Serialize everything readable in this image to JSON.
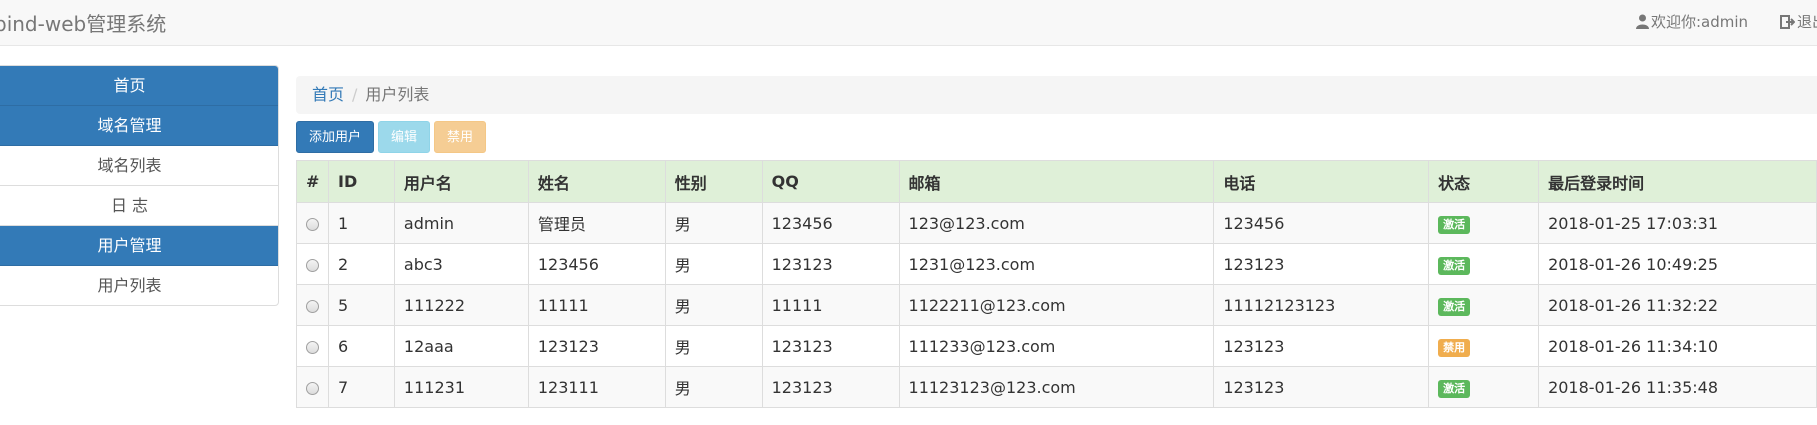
{
  "navbar": {
    "brand": "bind-web管理系统",
    "welcome": "欢迎你:admin",
    "welcome_icon": "user-icon",
    "logout": "退出",
    "logout_icon": "logout-icon"
  },
  "sidebar": {
    "items": [
      {
        "label": "首页",
        "active": true
      },
      {
        "label": "域名管理",
        "active": true
      },
      {
        "label": "域名列表",
        "active": false
      },
      {
        "label": "日 志",
        "active": false
      },
      {
        "label": "用户管理",
        "active": true
      },
      {
        "label": "用户列表",
        "active": false
      }
    ]
  },
  "breadcrumb": {
    "home": "首页",
    "separator": "/",
    "current": "用户列表"
  },
  "toolbar": {
    "add_label": "添加用户",
    "edit_label": "编辑",
    "disable_label": "禁用"
  },
  "table": {
    "headers": [
      "#",
      "ID",
      "用户名",
      "姓名",
      "性别",
      "QQ",
      "邮箱",
      "电话",
      "状态",
      "最后登录时间"
    ],
    "rows": [
      {
        "id": "1",
        "username": "admin",
        "name": "管理员",
        "gender": "男",
        "qq": "123456",
        "email": "123@123.com",
        "phone": "123456",
        "status": "激活",
        "last_login": "2018-01-25 17:03:31"
      },
      {
        "id": "2",
        "username": "abc3",
        "name": "123456",
        "gender": "男",
        "qq": "123123",
        "email": "1231@123.com",
        "phone": "123123",
        "status": "激活",
        "last_login": "2018-01-26 10:49:25"
      },
      {
        "id": "5",
        "username": "111222",
        "name": "11111",
        "gender": "男",
        "qq": "11111",
        "email": "1122211@123.com",
        "phone": "11112123123",
        "status": "激活",
        "last_login": "2018-01-26 11:32:22"
      },
      {
        "id": "6",
        "username": "12aaa",
        "name": "123123",
        "gender": "男",
        "qq": "123123",
        "email": "111233@123.com",
        "phone": "123123",
        "status": "禁用",
        "last_login": "2018-01-26 11:34:10"
      },
      {
        "id": "7",
        "username": "111231",
        "name": "123111",
        "gender": "男",
        "qq": "123123",
        "email": "11123123@123.com",
        "phone": "123123",
        "status": "激活",
        "last_login": "2018-01-26 11:35:48"
      }
    ]
  },
  "colors": {
    "primary": "#337ab7",
    "header_row": "#dff0d8",
    "status_active": "#5cb85c",
    "status_disabled": "#f0ad4e"
  }
}
